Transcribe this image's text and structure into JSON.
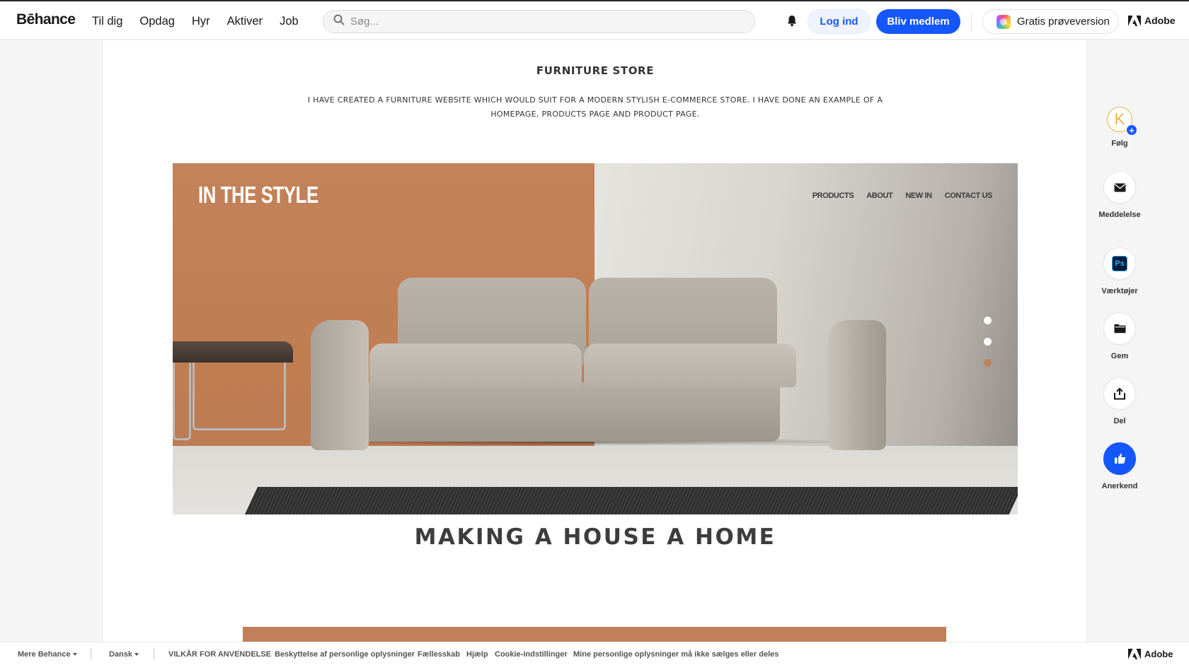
{
  "header": {
    "logo": "Bēhance",
    "nav": [
      "Til dig",
      "Opdag",
      "Hyr",
      "Aktiver",
      "Job"
    ],
    "search_placeholder": "Søg...",
    "login_label": "Log ind",
    "join_label": "Bliv medlem",
    "trial_label": "Gratis prøveversion",
    "adobe_label": "Adobe"
  },
  "project": {
    "title": "FURNITURE STORE",
    "description": "I HAVE CREATED A FURNITURE WEBSITE WHICH WOULD SUIT FOR A MODERN STYLISH E-COMMERCE STORE. I HAVE DONE AN EXAMPLE OF A HOMEPAGE, PRODUCTS PAGE AND PRODUCT PAGE.",
    "hero": {
      "brand": "IN THE STYLE",
      "nav": [
        "PRODUCTS",
        "ABOUT",
        "NEW IN",
        "CONTACT US"
      ],
      "slide_dots": [
        "inactive",
        "inactive",
        "active"
      ],
      "colors": {
        "accent": "#c0805a",
        "dot_active": "#c0805a",
        "dot_inactive": "#ffffff"
      }
    },
    "headline": "MAKING A HOUSE A HOME"
  },
  "rail": {
    "avatar_letter": "K",
    "follow": "Følg",
    "message": "Meddelelse",
    "tools": "Værktøjer",
    "tools_badge": "Ps",
    "save": "Gem",
    "share": "Del",
    "appreciate": "Anerkend"
  },
  "footer": {
    "more": "Mere Behance",
    "language": "Dansk",
    "links": [
      "VILKÅR FOR ANVENDELSE",
      "Beskyttelse af personlige oplysninger",
      "Fællesskab",
      "Hjælp",
      "Cookie-indstillinger",
      "Mine personlige oplysninger må ikke sælges eller deles"
    ],
    "adobe_label": "Adobe"
  },
  "colors": {
    "brand_blue": "#1557ff",
    "text": "#191919"
  }
}
